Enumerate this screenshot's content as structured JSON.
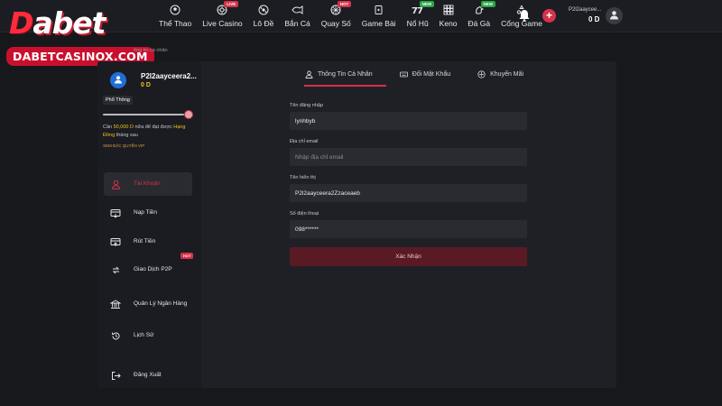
{
  "brand": {
    "logo_text": "Dabet",
    "site_label": "DABETCASINOX.COM",
    "topbar_fragment": "abet"
  },
  "nav": [
    {
      "label": "Thể Thao",
      "icon": "soccer-ball-icon",
      "badge": ""
    },
    {
      "label": "Live Casino",
      "icon": "roulette-icon",
      "badge": "LIVE"
    },
    {
      "label": "Lô Đề",
      "icon": "lottery-ball-icon",
      "badge": ""
    },
    {
      "label": "Bắn Cá",
      "icon": "fish-icon",
      "badge": ""
    },
    {
      "label": "Quay Số",
      "icon": "number-wheel-icon",
      "badge": "HOT"
    },
    {
      "label": "Game Bài",
      "icon": "cards-icon",
      "badge": ""
    },
    {
      "label": "Nổ Hũ",
      "icon": "slot-777-icon",
      "badge": "NEW"
    },
    {
      "label": "Keno",
      "icon": "keno-grid-icon",
      "badge": ""
    },
    {
      "label": "Đá Gà",
      "icon": "rooster-icon",
      "badge": "NEW"
    },
    {
      "label": "Cổng Game",
      "icon": "gamepad-icon",
      "badge": ""
    }
  ],
  "header": {
    "username": "P2l2aaycee...",
    "balance": "0 D"
  },
  "breadcrumb": "ông tin cá nhân",
  "sidebar": {
    "name": "P2l2aayceera2...",
    "balance": "0 D",
    "tier": "Phổ Thông",
    "progress": 0.95,
    "note_prefix": "Cần ",
    "note_amount": "50,000 D",
    "note_middle": " nữa để đạt được ",
    "note_target": "Hạng Đồng",
    "note_suffix": " tháng sau",
    "vip_link": "XEM ĐẶC QUYỀN VIP",
    "items": [
      {
        "label": "Tài Khoản",
        "icon": "user-icon",
        "active": true
      },
      {
        "label": "Nạp Tiền",
        "icon": "deposit-card-icon",
        "active": false
      },
      {
        "label": "Rút Tiền",
        "icon": "withdraw-card-icon",
        "active": false
      },
      {
        "label": "Giao Dịch P2P",
        "icon": "p2p-transfer-icon",
        "active": false,
        "badge": "HOT"
      },
      {
        "label": "Quản Lý Ngân Hàng",
        "icon": "bank-icon",
        "active": false
      },
      {
        "label": "Lịch Sử",
        "icon": "history-icon",
        "active": false
      },
      {
        "label": "Đăng Xuất",
        "icon": "logout-icon",
        "active": false
      }
    ]
  },
  "tabs": [
    {
      "label": "Thông Tin Cá Nhân",
      "icon": "user-icon",
      "active": true
    },
    {
      "label": "Đổi Mật Khẩu",
      "icon": "keyboard-icon",
      "active": false
    },
    {
      "label": "Khuyến Mãi",
      "icon": "gift-icon",
      "active": false
    }
  ],
  "form": {
    "username_label": "Tên đăng nhập",
    "username_value": "lynhbyb",
    "email_label": "Địa chỉ email",
    "email_placeholder": "Nhập địa chỉ email",
    "display_label": "Tên hiển thị",
    "display_value": "P2l2aayceera2Zzaceaeb",
    "phone_label": "Số điện thoại",
    "phone_value": "098****** ",
    "submit_label": "Xác Nhận"
  },
  "colors": {
    "accent": "#d6324a",
    "gold": "#f0c419",
    "background": "#17181c",
    "panel": "#1f2025",
    "input": "#2a2b31"
  }
}
